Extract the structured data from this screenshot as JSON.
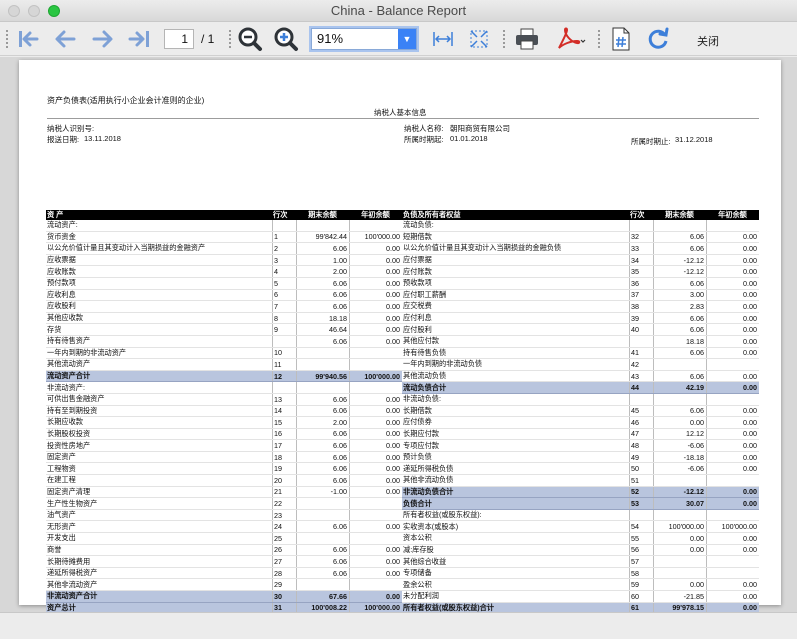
{
  "window": {
    "title": "China - Balance Report"
  },
  "toolbar": {
    "current_page": "1",
    "total_pages": "/ 1",
    "zoom": "91%",
    "close_label": "关闭",
    "icons": [
      "first-page-icon",
      "prev-page-icon",
      "next-page-icon",
      "last-page-icon",
      "zoom-out-icon",
      "zoom-in-icon",
      "fit-width-icon",
      "fit-page-icon",
      "print-icon",
      "pdf-icon",
      "excel-icon",
      "refresh-icon"
    ]
  },
  "report": {
    "title": "资产负债表(适用执行小企业会计准则的企业)",
    "section_title": "纳税人基本信息",
    "taxpayer_id_label": "纳税人识别号:",
    "taxpayer_name_label": "纳税人名称:",
    "taxpayer_name": "朝阳商贸有限公司",
    "submit_date_label": "报送日期:",
    "submit_date": "13.11.2018",
    "period_start_label": "所属时期起:",
    "period_start": "01.01.2018",
    "period_end_label": "所属时期止:",
    "period_end": "31.12.2018",
    "left_header": [
      "资 产",
      "行次",
      "期末余额",
      "年初余额"
    ],
    "right_header": [
      "负债及所有者权益",
      "行次",
      "期末余额",
      "年初余额"
    ],
    "left_rows": [
      {
        "name": "流动资产:",
        "line": "",
        "end": "",
        "start": ""
      },
      {
        "name": "货币资金",
        "line": "1",
        "end": "99'842.44",
        "start": "100'000.00"
      },
      {
        "name": "以公允价值计量且其变动计入当期损益的金融资产",
        "line": "2",
        "end": "6.06",
        "start": "0.00"
      },
      {
        "name": "应收票据",
        "line": "3",
        "end": "1.00",
        "start": "0.00"
      },
      {
        "name": "应收账款",
        "line": "4",
        "end": "2.00",
        "start": "0.00"
      },
      {
        "name": "预付款项",
        "line": "5",
        "end": "6.06",
        "start": "0.00"
      },
      {
        "name": "应收利息",
        "line": "6",
        "end": "6.06",
        "start": "0.00"
      },
      {
        "name": "应收股利",
        "line": "7",
        "end": "6.06",
        "start": "0.00"
      },
      {
        "name": "其他应收款",
        "line": "8",
        "end": "18.18",
        "start": "0.00"
      },
      {
        "name": "存货",
        "line": "9",
        "end": "46.64",
        "start": "0.00"
      },
      {
        "name": "持有待售资产",
        "line": "",
        "end": "6.06",
        "start": "0.00"
      },
      {
        "name": "一年内到期的非流动资产",
        "line": "10",
        "end": "",
        "start": ""
      },
      {
        "name": "其他流动资产",
        "line": "11",
        "end": "",
        "start": ""
      },
      {
        "name": "流动资产合计",
        "line": "12",
        "end": "99'940.56",
        "start": "100'000.00",
        "sub": true
      },
      {
        "name": "非流动资产:",
        "line": "",
        "end": "",
        "start": ""
      },
      {
        "name": "可供出售金融资产",
        "line": "13",
        "end": "6.06",
        "start": "0.00"
      },
      {
        "name": "持有至到期投资",
        "line": "14",
        "end": "6.06",
        "start": "0.00"
      },
      {
        "name": "长期应收款",
        "line": "15",
        "end": "2.00",
        "start": "0.00"
      },
      {
        "name": "长期股权投资",
        "line": "16",
        "end": "6.06",
        "start": "0.00"
      },
      {
        "name": "投资性房地产",
        "line": "17",
        "end": "6.06",
        "start": "0.00"
      },
      {
        "name": "固定资产",
        "line": "18",
        "end": "6.06",
        "start": "0.00"
      },
      {
        "name": "工程物资",
        "line": "19",
        "end": "6.06",
        "start": "0.00"
      },
      {
        "name": "在建工程",
        "line": "20",
        "end": "6.06",
        "start": "0.00"
      },
      {
        "name": "固定资产清理",
        "line": "21",
        "end": "-1.00",
        "start": "0.00"
      },
      {
        "name": "生产性生物资产",
        "line": "22",
        "end": "",
        "start": ""
      },
      {
        "name": "油气资产",
        "line": "23",
        "end": "",
        "start": ""
      },
      {
        "name": "无形资产",
        "line": "24",
        "end": "6.06",
        "start": "0.00"
      },
      {
        "name": "开发支出",
        "line": "25",
        "end": "",
        "start": ""
      },
      {
        "name": "商誉",
        "line": "26",
        "end": "6.06",
        "start": "0.00"
      },
      {
        "name": "长期待摊费用",
        "line": "27",
        "end": "6.06",
        "start": "0.00"
      },
      {
        "name": "递延所得税资产",
        "line": "28",
        "end": "6.06",
        "start": "0.00"
      },
      {
        "name": "其他非流动资产",
        "line": "29",
        "end": "",
        "start": ""
      },
      {
        "name": "非流动资产合计",
        "line": "30",
        "end": "67.66",
        "start": "0.00",
        "sub": true
      },
      {
        "name": "资产总计",
        "line": "31",
        "end": "100'008.22",
        "start": "100'000.00",
        "sub": true
      }
    ],
    "right_rows": [
      {
        "name": "流动负债:",
        "line": "",
        "end": "",
        "start": ""
      },
      {
        "name": "短期借款",
        "line": "32",
        "end": "6.06",
        "start": "0.00"
      },
      {
        "name": "以公允价值计量且其变动计入当期损益的金融负债",
        "line": "33",
        "end": "6.06",
        "start": "0.00"
      },
      {
        "name": "应付票据",
        "line": "34",
        "end": "-12.12",
        "start": "0.00"
      },
      {
        "name": "应付账款",
        "line": "35",
        "end": "-12.12",
        "start": "0.00"
      },
      {
        "name": "预收款项",
        "line": "36",
        "end": "6.06",
        "start": "0.00"
      },
      {
        "name": "应付职工薪酬",
        "line": "37",
        "end": "3.00",
        "start": "0.00"
      },
      {
        "name": "应交税费",
        "line": "38",
        "end": "2.83",
        "start": "0.00"
      },
      {
        "name": "应付利息",
        "line": "39",
        "end": "6.06",
        "start": "0.00"
      },
      {
        "name": "应付股利",
        "line": "40",
        "end": "6.06",
        "start": "0.00"
      },
      {
        "name": "其他应付款",
        "line": "",
        "end": "18.18",
        "start": "0.00"
      },
      {
        "name": "持有待售负债",
        "line": "41",
        "end": "6.06",
        "start": "0.00"
      },
      {
        "name": "一年内到期的非流动负债",
        "line": "42",
        "end": "",
        "start": ""
      },
      {
        "name": "其他流动负债",
        "line": "43",
        "end": "6.06",
        "start": "0.00"
      },
      {
        "name": "流动负债合计",
        "line": "44",
        "end": "42.19",
        "start": "0.00",
        "sub": true
      },
      {
        "name": "非流动负债:",
        "line": "",
        "end": "",
        "start": ""
      },
      {
        "name": "长期借款",
        "line": "45",
        "end": "6.06",
        "start": "0.00"
      },
      {
        "name": "应付债券",
        "line": "46",
        "end": "0.00",
        "start": "0.00"
      },
      {
        "name": "长期应付款",
        "line": "47",
        "end": "12.12",
        "start": "0.00"
      },
      {
        "name": "专项应付款",
        "line": "48",
        "end": "-6.06",
        "start": "0.00"
      },
      {
        "name": "预计负债",
        "line": "49",
        "end": "-18.18",
        "start": "0.00"
      },
      {
        "name": "递延所得税负债",
        "line": "50",
        "end": "-6.06",
        "start": "0.00"
      },
      {
        "name": "其他非流动负债",
        "line": "51",
        "end": "",
        "start": ""
      },
      {
        "name": "非流动负债合计",
        "line": "52",
        "end": "-12.12",
        "start": "0.00",
        "sub": true
      },
      {
        "name": "负债合计",
        "line": "53",
        "end": "30.07",
        "start": "0.00",
        "sub": true
      },
      {
        "name": "所有者权益(或股东权益):",
        "line": "",
        "end": "",
        "start": ""
      },
      {
        "name": "实收资本(或股本)",
        "line": "54",
        "end": "100'000.00",
        "start": "100'000.00"
      },
      {
        "name": "资本公积",
        "line": "55",
        "end": "0.00",
        "start": "0.00"
      },
      {
        "name": "减:库存股",
        "line": "56",
        "end": "0.00",
        "start": "0.00"
      },
      {
        "name": "其他综合收益",
        "line": "57",
        "end": "",
        "start": ""
      },
      {
        "name": "专项储备",
        "line": "58",
        "end": "",
        "start": ""
      },
      {
        "name": "盈余公积",
        "line": "59",
        "end": "0.00",
        "start": "0.00"
      },
      {
        "name": "未分配利润",
        "line": "60",
        "end": "-21.85",
        "start": "0.00"
      },
      {
        "name": "所有者权益(或股东权益)合计",
        "line": "61",
        "end": "99'978.15",
        "start": "0.00",
        "sub": true
      },
      {
        "name": "负债及所有者权益总计",
        "line": "62",
        "end": "100'008.22",
        "start": "100'000.00",
        "sub": true
      }
    ]
  }
}
